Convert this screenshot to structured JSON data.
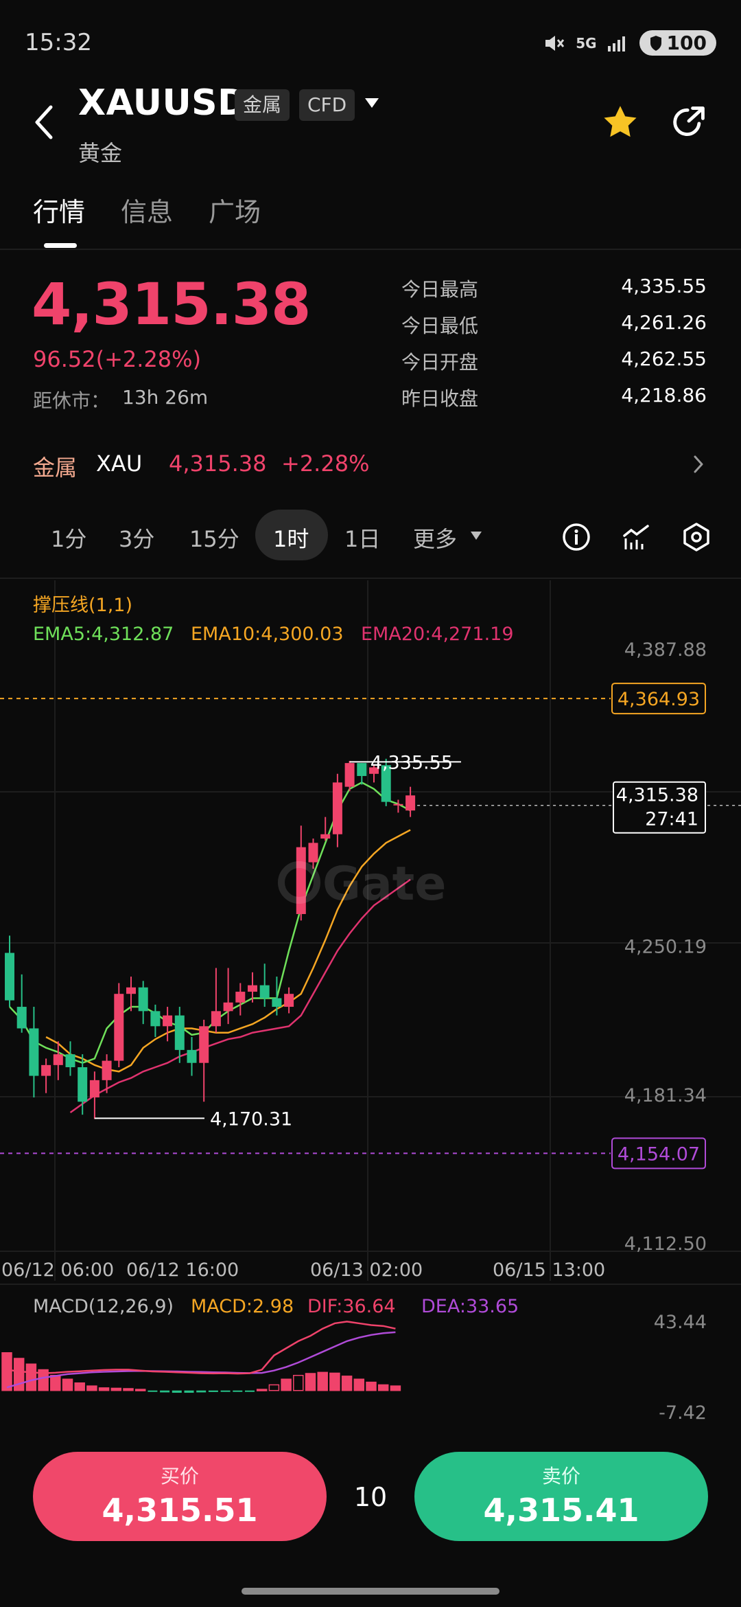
{
  "status_bar": {
    "time": "15:32",
    "network": "5G",
    "battery": "100"
  },
  "header": {
    "symbol": "XAUUSD",
    "tags": [
      "金属",
      "CFD"
    ],
    "name": "黄金"
  },
  "tabs": [
    {
      "label": "行情",
      "active": true
    },
    {
      "label": "信息",
      "active": false
    },
    {
      "label": "广场",
      "active": false
    }
  ],
  "quote": {
    "last": "4,315.38",
    "change": "96.52(+2.28%)",
    "close_label": "距休市：",
    "close_in": "13h 26m",
    "stats": [
      {
        "label": "今日最高",
        "value": "4,335.55"
      },
      {
        "label": "今日最低",
        "value": "4,261.26"
      },
      {
        "label": "今日开盘",
        "value": "4,262.55"
      },
      {
        "label": "昨日收盘",
        "value": "4,218.86"
      }
    ]
  },
  "related": {
    "category": "金属",
    "symbol": "XAU",
    "price": "4,315.38",
    "pct": "+2.28%"
  },
  "intervals": {
    "items": [
      "1分",
      "3分",
      "15分",
      "1时",
      "1日"
    ],
    "active": "1时",
    "more": "更多"
  },
  "colors": {
    "up": "#f0436b",
    "down": "#27c088",
    "ema5": "#6fe05a",
    "ema10": "#f5a623",
    "ema20": "#e0336f",
    "resistance": "#f5a623",
    "support": "#b04bd8"
  },
  "chart_data": {
    "type": "candlestick",
    "interval": "1时",
    "indicator_title": "撑压线(1,1)",
    "legend": [
      {
        "label": "EMA5:4,312.87",
        "color": "#6fe05a"
      },
      {
        "label": "EMA10:4,300.03",
        "color": "#f5a623"
      },
      {
        "label": "EMA20:4,271.19",
        "color": "#e0336f"
      }
    ],
    "y_ticks": [
      "4,387.88",
      "4,250.19",
      "4,181.34",
      "4,112.50"
    ],
    "ylim": [
      4112.5,
      4387.88
    ],
    "x_ticks": [
      "06/12 06:00",
      "06/12 16:00",
      "06/13 02:00",
      "06/15 13:00"
    ],
    "resistance": "4,364.93",
    "resistance_value": 4364.93,
    "support": "4,154.07",
    "support_value": 4154.07,
    "high_marker": "4,335.55",
    "high_value": 4335.55,
    "low_marker": "4,170.31",
    "low_value": 4170.31,
    "current_price": "4,315.38",
    "countdown": "27:41",
    "candles": [
      [
        4247,
        4255,
        4222,
        4225
      ],
      [
        4222,
        4237,
        4210,
        4212
      ],
      [
        4212,
        4222,
        4180,
        4190
      ],
      [
        4190,
        4198,
        4182,
        4195
      ],
      [
        4195,
        4206,
        4188,
        4200
      ],
      [
        4200,
        4206,
        4190,
        4194
      ],
      [
        4194,
        4200,
        4172,
        4178
      ],
      [
        4180,
        4192,
        4170,
        4188
      ],
      [
        4188,
        4200,
        4182,
        4197
      ],
      [
        4197,
        4233,
        4194,
        4228
      ],
      [
        4228,
        4236,
        4220,
        4231
      ],
      [
        4231,
        4234,
        4214,
        4220
      ],
      [
        4220,
        4223,
        4208,
        4213
      ],
      [
        4213,
        4222,
        4206,
        4218
      ],
      [
        4218,
        4222,
        4196,
        4202
      ],
      [
        4202,
        4208,
        4190,
        4196
      ],
      [
        4196,
        4216,
        4178,
        4213
      ],
      [
        4213,
        4240,
        4210,
        4220
      ],
      [
        4220,
        4240,
        4214,
        4224
      ],
      [
        4224,
        4233,
        4218,
        4229
      ],
      [
        4229,
        4238,
        4224,
        4232
      ],
      [
        4232,
        4242,
        4222,
        4226
      ],
      [
        4226,
        4236,
        4218,
        4222
      ],
      [
        4222,
        4231,
        4219,
        4228
      ],
      [
        4265,
        4306,
        4262,
        4296
      ],
      [
        4289,
        4300,
        4286,
        4298
      ],
      [
        4300,
        4310,
        4299,
        4302
      ],
      [
        4302,
        4330,
        4296,
        4326
      ],
      [
        4324,
        4336,
        4322,
        4335
      ],
      [
        4335,
        4335,
        4325,
        4329
      ],
      [
        4330,
        4334,
        4326,
        4333
      ],
      [
        4334,
        4337,
        4315,
        4317
      ],
      [
        4316,
        4318,
        4312,
        4316
      ],
      [
        4313,
        4324,
        4310,
        4320
      ]
    ],
    "ema5": [
      4222,
      4216,
      4206,
      4203,
      4201,
      4198,
      4196,
      4198,
      4212,
      4218,
      4222,
      4222,
      4219,
      4215,
      4213,
      4209,
      4210,
      4216,
      4220,
      4223,
      4226,
      4226,
      4226,
      4248,
      4268,
      4283,
      4298,
      4313,
      4323,
      4326,
      4323,
      4318,
      4316,
      4313
    ],
    "ema10": [
      4208,
      4205,
      4200,
      4198,
      4195,
      4193,
      4192,
      4195,
      4203,
      4207,
      4210,
      4212,
      4212,
      4211,
      4210,
      4210,
      4212,
      4214,
      4217,
      4221,
      4224,
      4228,
      4240,
      4253,
      4267,
      4278,
      4287,
      4293,
      4298,
      4301,
      4304
    ],
    "ema20": [
      4173,
      4177,
      4181,
      4184,
      4187,
      4189,
      4192,
      4194,
      4196,
      4199,
      4201,
      4203,
      4205,
      4207,
      4208,
      4210,
      4211,
      4212,
      4213,
      4218,
      4228,
      4238,
      4248,
      4256,
      4263,
      4269,
      4273,
      4277,
      4281
    ],
    "macd": {
      "title": "MACD(12,26,9)",
      "macd_label": "MACD:2.98",
      "dif_label": "DIF:36.64",
      "dea_label": "DEA:33.65",
      "y_ticks": [
        "43.44",
        "-7.42"
      ],
      "ylim": [
        -7.42,
        43.44
      ],
      "hist": [
        10,
        8.5,
        7,
        5.5,
        4,
        3,
        2,
        1.2,
        0.7,
        0.6,
        0.5,
        0.3,
        -0.3,
        -0.5,
        -0.6,
        -0.6,
        -0.5,
        -0.4,
        -0.3,
        -0.2,
        -0.1,
        0.3,
        1.5,
        3,
        4,
        4.5,
        4.8,
        4.6,
        3.8,
        3,
        2.2,
        1.5,
        1.2
      ],
      "dif": [
        14,
        13,
        12.5,
        12,
        12.3,
        12.8,
        13.1,
        13.5,
        13.8,
        14,
        14,
        13.5,
        13,
        12.8,
        12.5,
        12.3,
        12,
        11.9,
        12,
        11.8,
        12,
        14,
        22,
        26,
        30,
        33,
        37,
        40,
        41,
        40,
        39,
        38.5,
        37
      ],
      "dea": [
        4,
        6,
        8,
        9.5,
        10.5,
        11.5,
        12,
        12.5,
        12.8,
        13,
        13.2,
        13.3,
        13.2,
        13.1,
        13,
        12.8,
        12.7,
        12.5,
        12.4,
        12.2,
        12.1,
        12.2,
        13.5,
        15.5,
        18,
        21,
        24,
        27,
        30,
        32,
        33.5,
        34.5,
        35
      ]
    }
  },
  "trade": {
    "buy_label": "买价",
    "buy_price": "4,315.51",
    "quantity": "10",
    "sell_label": "卖价",
    "sell_price": "4,315.41"
  }
}
